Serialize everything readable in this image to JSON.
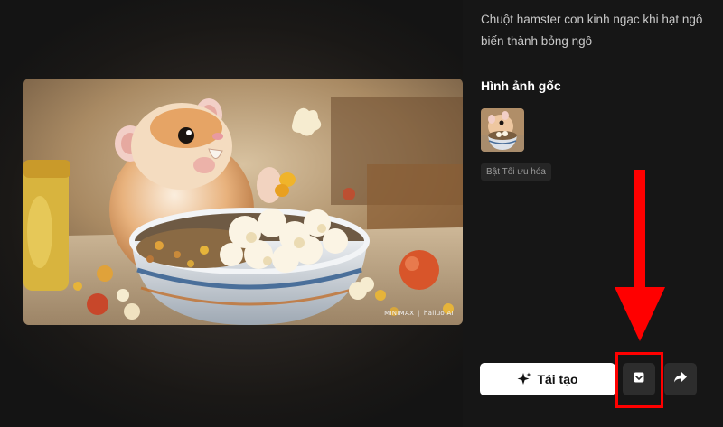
{
  "prompt": "Chuột hamster con kinh ngạc khi hạt ngô biến thành bỏng ngô",
  "original_image": {
    "title": "Hình ảnh gốc",
    "tag": "Bật Tối ưu hóa"
  },
  "video": {
    "watermark_brand": "MINIMAX",
    "watermark_product": "hailuo AI"
  },
  "actions": {
    "regenerate_label": "Tái tạo",
    "regenerate_icon": "sparkle-icon",
    "download_icon": "download-icon",
    "share_icon": "share-arrow-icon"
  },
  "annotation": {
    "color": "#ff0000"
  }
}
